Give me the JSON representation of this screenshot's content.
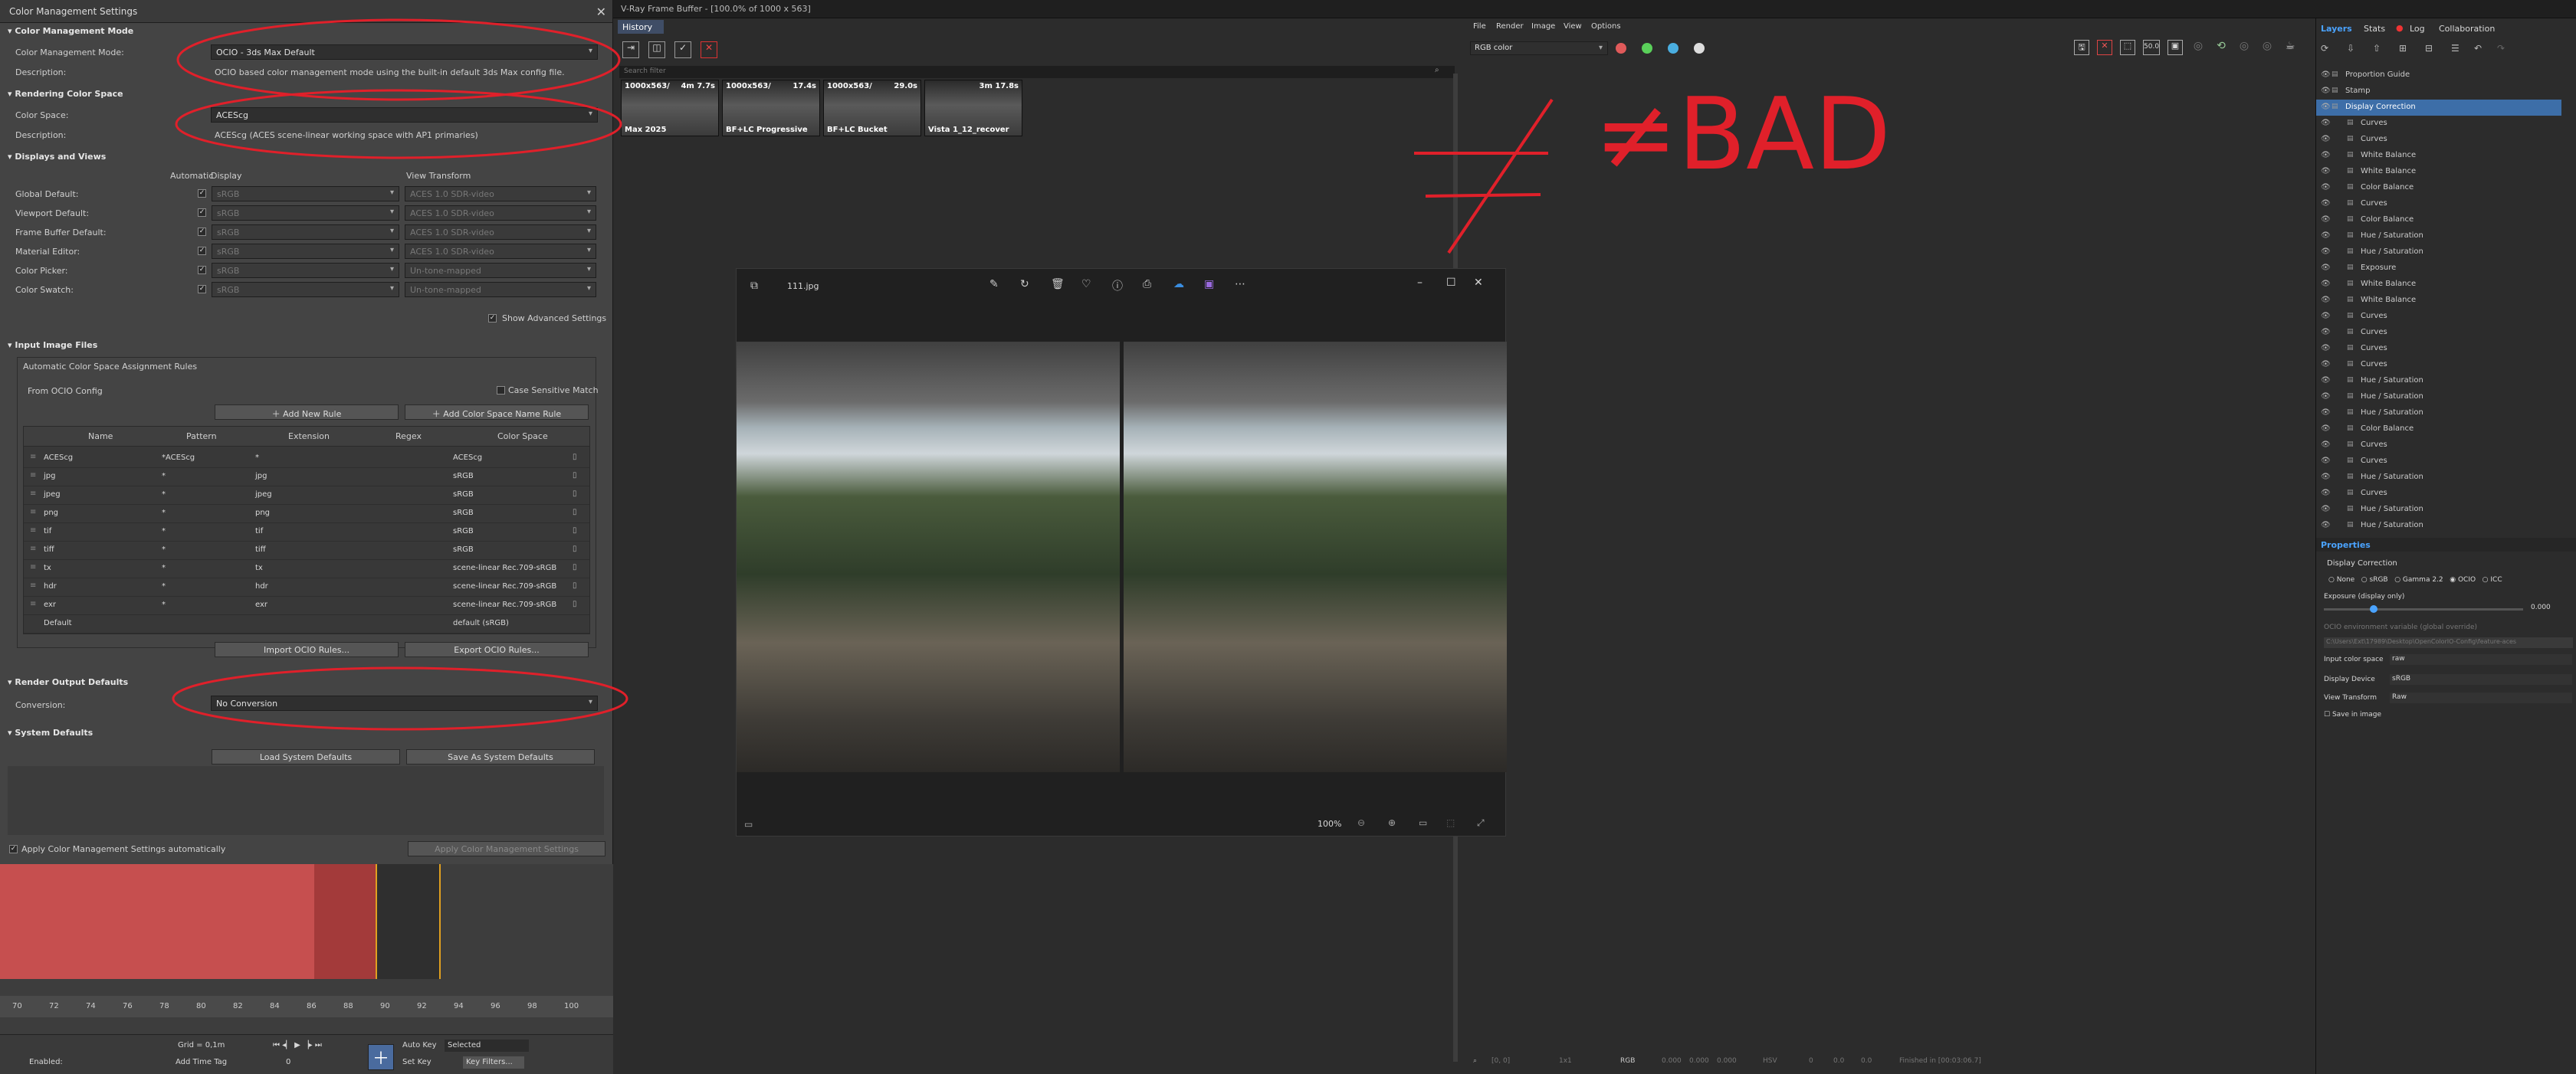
{
  "cms": {
    "title": "Color Management Settings",
    "sections": {
      "mode": "Color Management Mode",
      "rendering": "Rendering Color Space",
      "displays": "Displays and Views",
      "input": "Input Image Files",
      "output": "Render Output Defaults",
      "system": "System Defaults"
    },
    "mode_label": "Color Management Mode:",
    "mode_value": "OCIO - 3ds Max Default",
    "desc_label": "Description:",
    "mode_desc": "OCIO based color management mode using the built-in default 3ds Max config file.",
    "cs_label": "Color Space:",
    "cs_value": "ACEScg",
    "cs_desc": "ACEScg (ACES scene-linear working space with AP1 primaries)",
    "col_automatic": "Automatic",
    "col_display": "Display",
    "col_view": "View Transform",
    "display_rows": [
      {
        "label": "Global Default:",
        "display": "sRGB",
        "view": "ACES 1.0 SDR-video"
      },
      {
        "label": "Viewport Default:",
        "display": "sRGB",
        "view": "ACES 1.0 SDR-video"
      },
      {
        "label": "Frame Buffer Default:",
        "display": "sRGB",
        "view": "ACES 1.0 SDR-video"
      },
      {
        "label": "Material Editor:",
        "display": "sRGB",
        "view": "ACES 1.0 SDR-video"
      },
      {
        "label": "Color Picker:",
        "display": "sRGB",
        "view": "Un-tone-mapped"
      },
      {
        "label": "Color Swatch:",
        "display": "sRGB",
        "view": "Un-tone-mapped"
      }
    ],
    "show_advanced": "Show Advanced Settings",
    "auto_rules": "Automatic Color Space Assignment Rules",
    "from_ocio": "From OCIO Config",
    "case_sensitive": "Case Sensitive Match",
    "add_rule": "Add New Rule",
    "add_name_rule": "Add Color Space Name Rule",
    "rule_headers": [
      "Name",
      "Pattern",
      "Extension",
      "Regex",
      "Color Space"
    ],
    "rules": [
      {
        "name": "ACEScg",
        "pattern": "*ACEScg",
        "ext": "*",
        "cs": "ACEScg"
      },
      {
        "name": "jpg",
        "pattern": "*",
        "ext": "jpg",
        "cs": "sRGB"
      },
      {
        "name": "jpeg",
        "pattern": "*",
        "ext": "jpeg",
        "cs": "sRGB"
      },
      {
        "name": "png",
        "pattern": "*",
        "ext": "png",
        "cs": "sRGB"
      },
      {
        "name": "tif",
        "pattern": "*",
        "ext": "tif",
        "cs": "sRGB"
      },
      {
        "name": "tiff",
        "pattern": "*",
        "ext": "tiff",
        "cs": "sRGB"
      },
      {
        "name": "tx",
        "pattern": "*",
        "ext": "tx",
        "cs": "scene-linear Rec.709-sRGB"
      },
      {
        "name": "hdr",
        "pattern": "*",
        "ext": "hdr",
        "cs": "scene-linear Rec.709-sRGB"
      },
      {
        "name": "exr",
        "pattern": "*",
        "ext": "exr",
        "cs": "scene-linear Rec.709-sRGB"
      },
      {
        "name": "Default",
        "pattern": "",
        "ext": "",
        "cs": "default (sRGB)"
      }
    ],
    "import_rules": "Import OCIO Rules...",
    "export_rules": "Export OCIO Rules...",
    "conversion_label": "Conversion:",
    "conversion_value": "No Conversion",
    "load_defaults": "Load System Defaults",
    "save_defaults": "Save As System Defaults",
    "apply_auto": "Apply Color Management Settings automatically",
    "apply_btn": "Apply Color Management Settings"
  },
  "timeline": {
    "ticks": [
      "70",
      "72",
      "74",
      "76",
      "78",
      "80",
      "82",
      "84",
      "86",
      "88",
      "90",
      "92",
      "94",
      "96",
      "98",
      "100"
    ],
    "grid": "Grid = 0,1m",
    "auto_key": "Auto Key",
    "set_key": "Set Key",
    "selected": "Selected",
    "key_filters": "Key Filters...",
    "enabled": "Enabled:",
    "add_time_tag": "Add Time Tag",
    "frame": "0"
  },
  "vfb": {
    "title": "V-Ray Frame Buffer - [100.0% of 1000 x 563]",
    "history_tab": "History",
    "search_placeholder": "Search filter",
    "thumbs": [
      {
        "top": "1000x563/",
        "time": "4m 7.7s",
        "name": "Max 2025"
      },
      {
        "top": "1000x563/",
        "time": "17.4s",
        "name": "BF+LC Progressive"
      },
      {
        "top": "1000x563/",
        "time": "29.0s",
        "name": "BF+LC Bucket"
      },
      {
        "top": "",
        "time": "3m 17.8s",
        "name": "Vista 1_12_recover"
      }
    ],
    "menu": [
      "File",
      "Render",
      "Image",
      "View",
      "Options"
    ],
    "channel": "RGB color",
    "zoom_badge": "50.0",
    "status_coords": "[0, 0]",
    "status_ratio": "1x1",
    "status_mode": "RGB",
    "status_values": [
      "0.000",
      "0.000",
      "0.000"
    ],
    "status_hsv": "HSV",
    "status_hsv_values": [
      "0",
      "0.0",
      "0.0"
    ],
    "status_finished": "Finished in [00:03:06.7]"
  },
  "photos": {
    "filename": "111.jpg",
    "zoom": "100%"
  },
  "annotation": {
    "text": "≠BAD",
    "color": "#e0202a"
  },
  "layers": {
    "tabs": [
      "Layers",
      "Stats",
      "Log",
      "Collaboration"
    ],
    "items": [
      "Proportion Guide",
      "Stamp",
      "Display Correction",
      "Curves",
      "Curves",
      "White Balance",
      "White Balance",
      "Color Balance",
      "Curves",
      "Color Balance",
      "Hue / Saturation",
      "Hue / Saturation",
      "Exposure",
      "White Balance",
      "White Balance",
      "Curves",
      "Curves",
      "Curves",
      "Curves",
      "Hue / Saturation",
      "Hue / Saturation",
      "Hue / Saturation",
      "Color Balance",
      "Curves",
      "Curves",
      "Hue / Saturation",
      "Curves",
      "Hue / Saturation",
      "Hue / Saturation"
    ],
    "properties_tab": "Properties",
    "prop_title": "Display Correction",
    "radio_none": "None",
    "radio_srgb": "sRGB",
    "radio_gamma": "Gamma 2.2",
    "radio_ocio": "OCIO",
    "radio_icc": "ICC",
    "exposure_label": "Exposure (display only)",
    "exposure_value": "0.000",
    "ocio_env": "OCIO environment variable (global override)",
    "ocio_path": "C:\\Users\\Ext\\17989\\Desktop\\OpenColorIO-Config\\feature-aces",
    "input_cs_label": "Input color space",
    "input_cs_value": "raw",
    "display_device_label": "Display Device",
    "display_device_value": "sRGB",
    "view_transform_label": "View Transform",
    "view_transform_value": "Raw",
    "save_in_image": "Save in image"
  }
}
